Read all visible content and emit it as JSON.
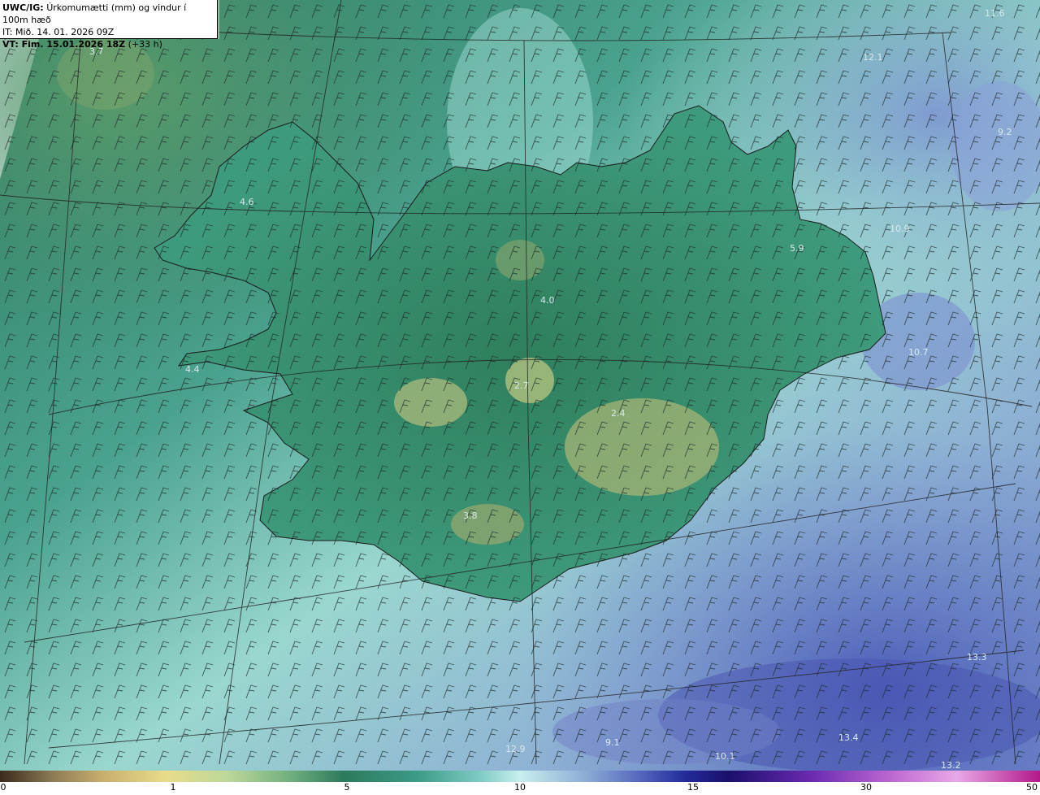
{
  "header": {
    "model_label": "UWC/IG:",
    "variable": "Úrkomumætti (mm) og vindur í 100m hæð",
    "init_time": "IT: Mið. 14. 01. 2026 09Z",
    "valid_prefix": "VT: Fim. 15.01.2026 18Z",
    "lead_time": "(+33 h)"
  },
  "map": {
    "values": [
      {
        "id": "nw-sea",
        "text": "3.7"
      },
      {
        "id": "westfjords",
        "text": "4.6"
      },
      {
        "id": "snaefellsnes",
        "text": "4.4"
      },
      {
        "id": "north-central",
        "text": "4.0"
      },
      {
        "id": "highland-center",
        "text": "2.7"
      },
      {
        "id": "vatnajokull",
        "text": "2.4"
      },
      {
        "id": "east",
        "text": "5.9"
      },
      {
        "id": "south",
        "text": "3.8"
      },
      {
        "id": "ne-sea-top",
        "text": "11.6"
      },
      {
        "id": "ne-sea",
        "text": "12.1"
      },
      {
        "id": "east-sea-1",
        "text": "9.2"
      },
      {
        "id": "east-sea-2",
        "text": "10.9"
      },
      {
        "id": "east-sea-3",
        "text": "10.7"
      },
      {
        "id": "se-sea",
        "text": "13.3"
      },
      {
        "id": "south-sea-1",
        "text": "12.9"
      },
      {
        "id": "south-sea-2",
        "text": "9.1"
      },
      {
        "id": "south-sea-3",
        "text": "10.1"
      },
      {
        "id": "south-sea-4",
        "text": "13.4"
      },
      {
        "id": "south-sea-5",
        "text": "13.2"
      }
    ]
  },
  "colorbar": {
    "ticks": [
      "0",
      "1",
      "5",
      "10",
      "15",
      "30",
      "50"
    ]
  }
}
